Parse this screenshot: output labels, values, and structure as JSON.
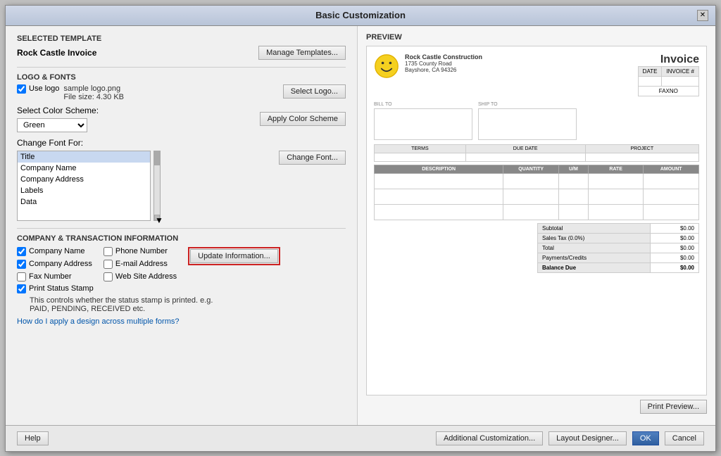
{
  "dialog": {
    "title": "Basic Customization",
    "close_label": "✕"
  },
  "selected_template": {
    "label": "SELECTED TEMPLATE",
    "name": "Rock Castle Invoice",
    "manage_btn": "Manage Templates..."
  },
  "logo_fonts": {
    "label": "LOGO & FONTS",
    "use_logo_label": "Use logo",
    "logo_filename": "sample logo.png",
    "logo_filesize": "File size: 4.30 KB",
    "select_logo_btn": "Select Logo...",
    "color_scheme_label": "Select Color Scheme:",
    "color_scheme_value": "Green",
    "apply_color_btn": "Apply Color Scheme",
    "change_font_label": "Change Font For:",
    "change_font_btn": "Change Font...",
    "font_items": [
      "Title",
      "Company Name",
      "Company Address",
      "Labels",
      "Data"
    ]
  },
  "company_info": {
    "label": "COMPANY & TRANSACTION INFORMATION",
    "company_name_label": "Company Name",
    "company_address_label": "Company Address",
    "fax_number_label": "Fax Number",
    "phone_number_label": "Phone Number",
    "email_address_label": "E-mail Address",
    "website_label": "Web Site Address",
    "update_btn": "Update Information...",
    "print_stamp_label": "Print Status Stamp",
    "stamp_desc": "This controls whether the status stamp is printed. e.g.",
    "stamp_desc2": "PAID, PENDING, RECEIVED etc.",
    "help_link": "How do I apply a design across multiple forms?"
  },
  "preview": {
    "label": "PREVIEW",
    "company_name": "Rock Castle Construction",
    "company_address": "1735 County Road",
    "company_city": "Bayshore, CA 94326",
    "invoice_title": "Invoice",
    "bill_to_label": "BILL TO",
    "ship_to_label": "SHIP TO",
    "date_label": "DATE",
    "invoice_num_label": "INVOICE #",
    "fax_label": "FAXNO",
    "terms_label": "TERMS",
    "due_date_label": "DUE DATE",
    "project_label": "PROJECT",
    "description_label": "DESCRIPTION",
    "quantity_label": "QUANTITY",
    "um_label": "U/M",
    "rate_label": "RATE",
    "amount_label": "AMOUNT",
    "subtotal_label": "Subtotal",
    "subtotal_val": "$0.00",
    "sales_tax_label": "Sales Tax (0.0%)",
    "sales_tax_val": "$0.00",
    "total_label": "Total",
    "total_val": "$0.00",
    "payments_label": "Payments/Credits",
    "payments_val": "$0.00",
    "balance_label": "Balance Due",
    "balance_val": "$0.00",
    "print_preview_btn": "Print Preview..."
  },
  "bottom_bar": {
    "help_btn": "Help",
    "additional_btn": "Additional Customization...",
    "layout_btn": "Layout Designer...",
    "ok_btn": "OK",
    "cancel_btn": "Cancel"
  }
}
